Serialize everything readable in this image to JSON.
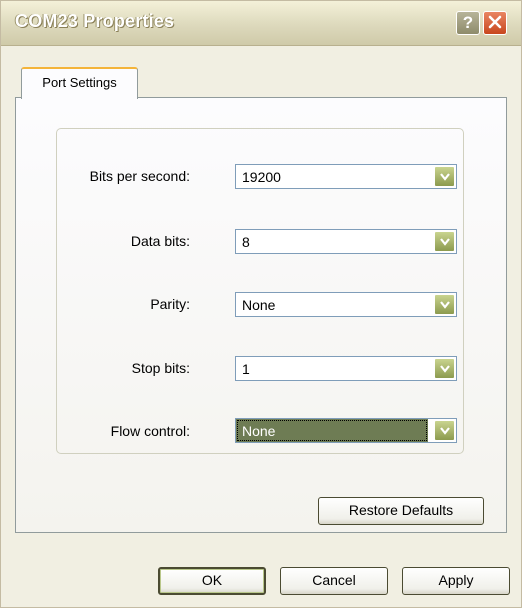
{
  "window": {
    "title": "COM23 Properties",
    "help_label": "?"
  },
  "tabs": [
    {
      "label": "Port Settings",
      "active": true
    }
  ],
  "settings": {
    "bits_per_second": {
      "label": "Bits per second:",
      "value": "19200"
    },
    "data_bits": {
      "label": "Data bits:",
      "value": "8"
    },
    "parity": {
      "label": "Parity:",
      "value": "None"
    },
    "stop_bits": {
      "label": "Stop bits:",
      "value": "1"
    },
    "flow_control": {
      "label": "Flow control:",
      "value": "None"
    }
  },
  "buttons": {
    "restore_defaults": "Restore Defaults",
    "ok": "OK",
    "cancel": "Cancel",
    "apply": "Apply"
  },
  "colors": {
    "accent": "#f4b43a",
    "dropdown_button": "#9aa85a",
    "selection": "#6e7c54"
  }
}
